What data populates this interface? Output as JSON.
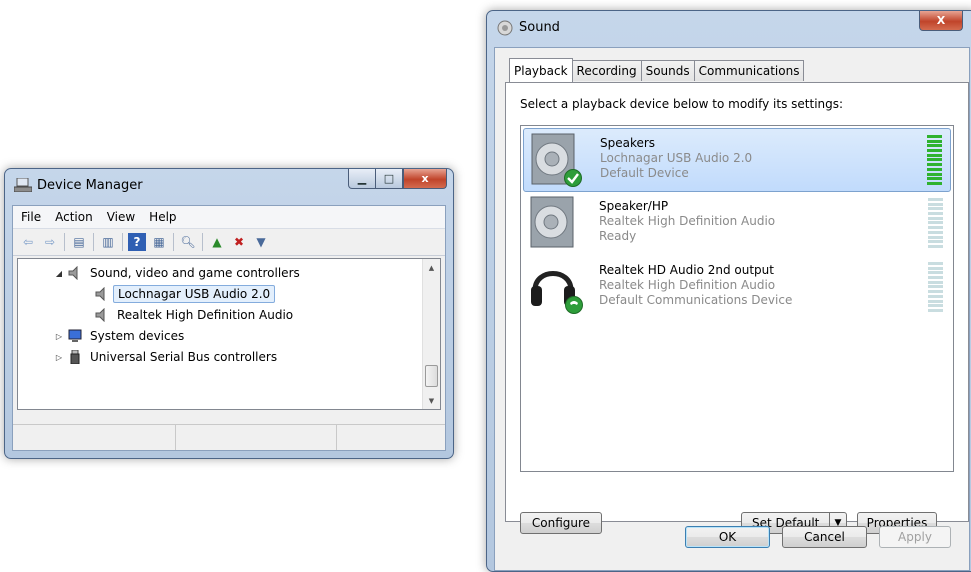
{
  "device_manager": {
    "title": "Device Manager",
    "menu": [
      "File",
      "Action",
      "View",
      "Help"
    ],
    "tree": [
      {
        "label": "Sound, video and game controllers",
        "expanded": true
      },
      {
        "label": "Lochnagar USB Audio 2.0",
        "selected": true
      },
      {
        "label": "Realtek High Definition Audio"
      },
      {
        "label": "System devices"
      },
      {
        "label": "Universal Serial Bus controllers"
      }
    ],
    "caption_buttons": {
      "minimize": "minimize-icon",
      "maximize": "maximize-icon",
      "close": "close-icon"
    }
  },
  "sound_dialog": {
    "title": "Sound",
    "tabs": [
      "Playback",
      "Recording",
      "Sounds",
      "Communications"
    ],
    "active_tab": "Playback",
    "instruction": "Select a playback device below to modify its settings:",
    "devices": [
      {
        "name": "Speakers",
        "driver": "Lochnagar USB Audio 2.0",
        "status": "Default Device",
        "icon": "speaker-icon",
        "badge": "green-checkmark-icon",
        "level": 1.0
      },
      {
        "name": "Speaker/HP",
        "driver": "Realtek High Definition Audio",
        "status": "Ready",
        "icon": "speaker-icon",
        "level": 0
      },
      {
        "name": "Realtek HD Audio 2nd output",
        "driver": "Realtek High Definition Audio",
        "status": "Default Communications Device",
        "icon": "headphones-icon",
        "badge": "green-phone-icon",
        "level": 0
      }
    ],
    "buttons": {
      "configure": "Configure",
      "set_default": "Set Default",
      "properties": "Properties",
      "ok": "OK",
      "cancel": "Cancel",
      "apply": "Apply"
    },
    "close": "X"
  },
  "colors": {
    "selection": "#c1dbfc",
    "meter_active": "#2fb22f",
    "meter_idle": "#c9dde0",
    "close_button": "#c0442a"
  }
}
